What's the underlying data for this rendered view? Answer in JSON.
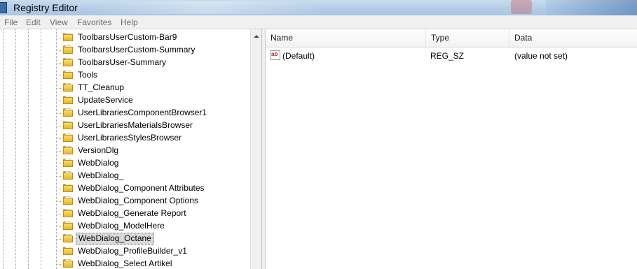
{
  "window": {
    "title": "Registry Editor"
  },
  "menu": [
    "File",
    "Edit",
    "View",
    "Favorites",
    "Help"
  ],
  "tree": {
    "items": [
      "ToolbarsUserCustom-Bar9",
      "ToolbarsUserCustom-Summary",
      "ToolbarsUser-Summary",
      "Tools",
      "TT_Cleanup",
      "UpdateService",
      "UserLibrariesComponentBrowser1",
      "UserLibrariesMaterialsBrowser",
      "UserLibrariesStylesBrowser",
      "VersionDlg",
      "WebDialog",
      "WebDialog_",
      "WebDialog_Component Attributes",
      "WebDialog_Component Options",
      "WebDialog_Generate Report",
      "WebDialog_ModelHere",
      "WebDialog_Octane",
      "WebDialog_ProfileBuilder_v1",
      "WebDialog_Select Artikel"
    ],
    "selected": "WebDialog_Octane"
  },
  "list": {
    "columns": {
      "name": "Name",
      "type": "Type",
      "data": "Data"
    },
    "rows": [
      {
        "icon": "string-value-icon",
        "icon_text": "ab",
        "name": "(Default)",
        "type": "REG_SZ",
        "data": "(value not set)"
      }
    ]
  }
}
